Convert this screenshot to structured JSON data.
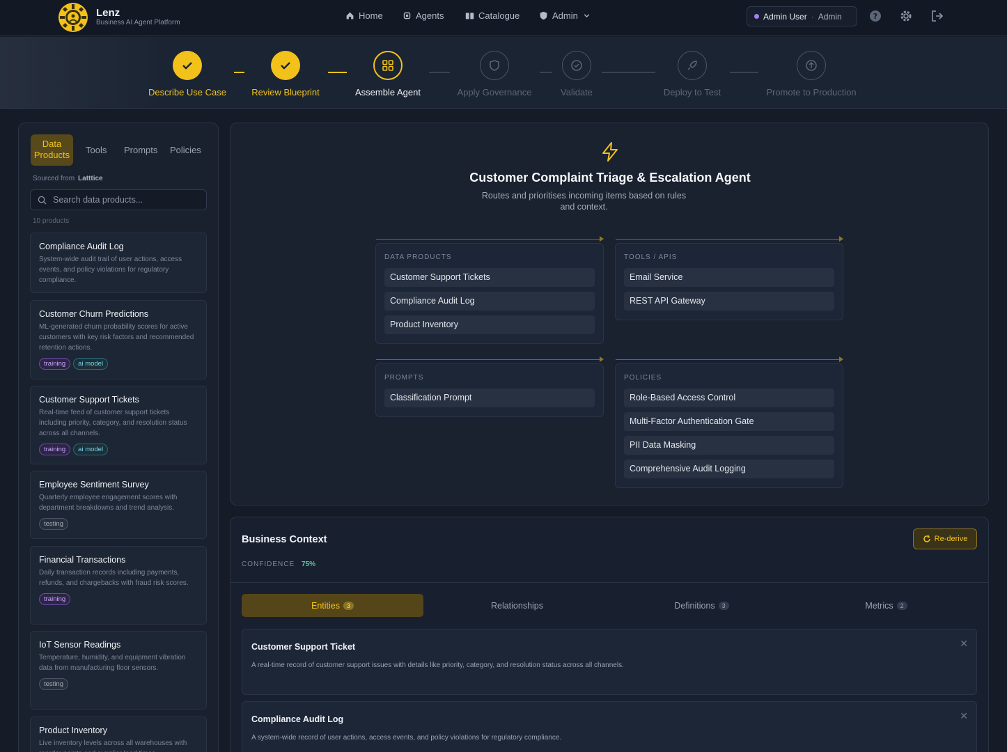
{
  "brand": {
    "name": "Lenz",
    "subtitle": "Business AI Agent Platform"
  },
  "nav": {
    "home": "Home",
    "agents": "Agents",
    "catalogue": "Catalogue",
    "admin": "Admin"
  },
  "user": {
    "name": "Admin User",
    "separator": "·",
    "role": "Admin"
  },
  "steps": [
    {
      "label": "Describe Use Case",
      "state": "done"
    },
    {
      "label": "Review Blueprint",
      "state": "done"
    },
    {
      "label": "Assemble Agent",
      "state": "active"
    },
    {
      "label": "Apply Governance",
      "state": "pending"
    },
    {
      "label": "Validate",
      "state": "pending"
    },
    {
      "label": "Deploy to Test",
      "state": "pending"
    },
    {
      "label": "Promote to Production",
      "state": "pending"
    }
  ],
  "library": {
    "tabs": {
      "data_products_1": "Data",
      "data_products_2": "Products",
      "tools": "Tools",
      "prompts": "Prompts",
      "policies": "Policies"
    },
    "sourced_label": "Sourced from",
    "sourced_value": "Latttice",
    "search_placeholder": "Search data products...",
    "count": "10 products",
    "cards": [
      {
        "title": "Compliance Audit Log",
        "desc": "System-wide audit trail of user actions, access events, and policy violations for regulatory compliance.",
        "tags": []
      },
      {
        "title": "Customer Churn Predictions",
        "desc": "ML-generated churn probability scores for active customers with key risk factors and recommended retention actions.",
        "tags": [
          "training",
          "ai model"
        ]
      },
      {
        "title": "Customer Support Tickets",
        "desc": "Real-time feed of customer support tickets including priority, category, and resolution status across all channels.",
        "tags": [
          "training",
          "ai model"
        ]
      },
      {
        "title": "Employee Sentiment Survey",
        "desc": "Quarterly employee engagement scores with department breakdowns and trend analysis.",
        "tags": [
          "testing"
        ]
      },
      {
        "title": "Financial Transactions",
        "desc": "Daily transaction records including payments, refunds, and chargebacks with fraud risk scores.",
        "tags": [
          "training"
        ]
      },
      {
        "title": "IoT Sensor Readings",
        "desc": "Temperature, humidity, and equipment vibration data from manufacturing floor sensors.",
        "tags": [
          "testing"
        ]
      },
      {
        "title": "Product Inventory",
        "desc": "Live inventory levels across all warehouses with reorder points and supplier lead times.",
        "tags": []
      }
    ]
  },
  "agent": {
    "title": "Customer Complaint Triage & Escalation Agent",
    "description": "Routes and prioritises incoming items based on rules and context.",
    "groups": {
      "data_products": {
        "label": "DATA PRODUCTS",
        "items": [
          "Customer Support Tickets",
          "Compliance Audit Log",
          "Product Inventory"
        ]
      },
      "tools": {
        "label": "TOOLS / APIS",
        "items": [
          "Email Service",
          "REST API Gateway"
        ]
      },
      "prompts": {
        "label": "PROMPTS",
        "items": [
          "Classification Prompt"
        ]
      },
      "policies": {
        "label": "POLICIES",
        "items": [
          "Role-Based Access Control",
          "Multi-Factor Authentication Gate",
          "PII Data Masking",
          "Comprehensive Audit Logging"
        ]
      }
    }
  },
  "context": {
    "title": "Business Context",
    "rederive": "Re-derive",
    "confidence_label": "CONFIDENCE",
    "confidence_value": "75%",
    "tabs": [
      {
        "label": "Entities",
        "badge": "3"
      },
      {
        "label": "Relationships",
        "badge": ""
      },
      {
        "label": "Definitions",
        "badge": "3"
      },
      {
        "label": "Metrics",
        "badge": "2"
      }
    ],
    "entities": [
      {
        "title": "Customer Support Ticket",
        "desc": "A real-time record of customer support issues with details like priority, category, and resolution status across all channels."
      },
      {
        "title": "Compliance Audit Log",
        "desc": "A system-wide record of user actions, access events, and policy violations for regulatory compliance."
      }
    ]
  },
  "colors": {
    "accent": "#f2c21b",
    "bg": "#151c28",
    "success": "#4ed19a",
    "user_dot": "#a87ef0"
  },
  "icons": [
    "logo-gear-icon",
    "home-icon",
    "agents-chip-icon",
    "catalogue-book-icon",
    "admin-shield-icon",
    "chevron-down-icon",
    "help-icon",
    "gear-icon",
    "logout-icon",
    "check-icon",
    "grid-icon",
    "shield-icon",
    "check-circle-icon",
    "rocket-icon",
    "upload-circle-icon",
    "search-icon",
    "bolt-icon",
    "refresh-icon",
    "close-icon"
  ]
}
